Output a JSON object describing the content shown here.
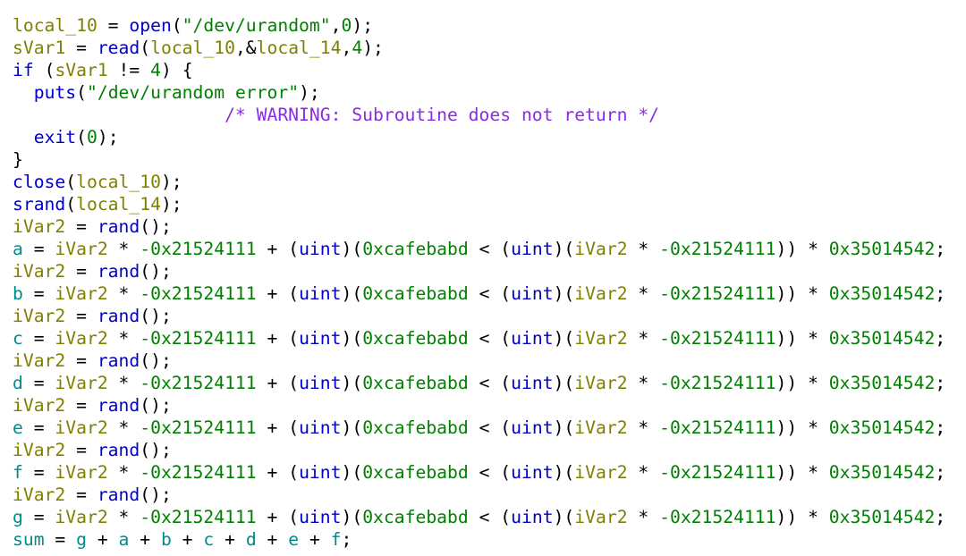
{
  "editor": {
    "lines": [
      [
        [
          "var",
          "local_10"
        ],
        [
          "plain",
          " = "
        ],
        [
          "func",
          "open"
        ],
        [
          "plain",
          "("
        ],
        [
          "string",
          "\"/dev/urandom\""
        ],
        [
          "plain",
          ","
        ],
        [
          "number",
          "0"
        ],
        [
          "plain",
          ");"
        ]
      ],
      [
        [
          "var",
          "sVar1"
        ],
        [
          "plain",
          " = "
        ],
        [
          "func",
          "read"
        ],
        [
          "plain",
          "("
        ],
        [
          "var",
          "local_10"
        ],
        [
          "plain",
          ",&"
        ],
        [
          "var",
          "local_14"
        ],
        [
          "plain",
          ","
        ],
        [
          "number",
          "4"
        ],
        [
          "plain",
          ");"
        ]
      ],
      [
        [
          "keyword",
          "if"
        ],
        [
          "plain",
          " ("
        ],
        [
          "var",
          "sVar1"
        ],
        [
          "plain",
          " != "
        ],
        [
          "number",
          "4"
        ],
        [
          "plain",
          ") {"
        ]
      ],
      [
        [
          "plain",
          "  "
        ],
        [
          "func",
          "puts"
        ],
        [
          "plain",
          "("
        ],
        [
          "string",
          "\"/dev/urandom error\""
        ],
        [
          "plain",
          ");"
        ]
      ],
      [
        [
          "plain",
          "                    "
        ],
        [
          "comment",
          "/* WARNING: Subroutine does not return */"
        ]
      ],
      [
        [
          "plain",
          "  "
        ],
        [
          "func",
          "exit"
        ],
        [
          "plain",
          "("
        ],
        [
          "number",
          "0"
        ],
        [
          "plain",
          ");"
        ]
      ],
      [
        [
          "plain",
          "}"
        ]
      ],
      [
        [
          "func",
          "close"
        ],
        [
          "plain",
          "("
        ],
        [
          "var",
          "local_10"
        ],
        [
          "plain",
          ");"
        ]
      ],
      [
        [
          "func",
          "srand"
        ],
        [
          "plain",
          "("
        ],
        [
          "var",
          "local_14"
        ],
        [
          "plain",
          ");"
        ]
      ],
      [
        [
          "var",
          "iVar2"
        ],
        [
          "plain",
          " = "
        ],
        [
          "func",
          "rand"
        ],
        [
          "plain",
          "();"
        ]
      ],
      [
        [
          "global",
          "a"
        ],
        [
          "plain",
          " = "
        ],
        [
          "var",
          "iVar2"
        ],
        [
          "plain",
          " * "
        ],
        [
          "number",
          "-0x21524111"
        ],
        [
          "plain",
          " + ("
        ],
        [
          "type",
          "uint"
        ],
        [
          "plain",
          ")("
        ],
        [
          "number",
          "0xcafebabd"
        ],
        [
          "plain",
          " < ("
        ],
        [
          "type",
          "uint"
        ],
        [
          "plain",
          ")("
        ],
        [
          "var",
          "iVar2"
        ],
        [
          "plain",
          " * "
        ],
        [
          "number",
          "-0x21524111"
        ],
        [
          "plain",
          ")) * "
        ],
        [
          "number",
          "0x35014542"
        ],
        [
          "plain",
          ";"
        ]
      ],
      [
        [
          "var",
          "iVar2"
        ],
        [
          "plain",
          " = "
        ],
        [
          "func",
          "rand"
        ],
        [
          "plain",
          "();"
        ]
      ],
      [
        [
          "global",
          "b"
        ],
        [
          "plain",
          " = "
        ],
        [
          "var",
          "iVar2"
        ],
        [
          "plain",
          " * "
        ],
        [
          "number",
          "-0x21524111"
        ],
        [
          "plain",
          " + ("
        ],
        [
          "type",
          "uint"
        ],
        [
          "plain",
          ")("
        ],
        [
          "number",
          "0xcafebabd"
        ],
        [
          "plain",
          " < ("
        ],
        [
          "type",
          "uint"
        ],
        [
          "plain",
          ")("
        ],
        [
          "var",
          "iVar2"
        ],
        [
          "plain",
          " * "
        ],
        [
          "number",
          "-0x21524111"
        ],
        [
          "plain",
          ")) * "
        ],
        [
          "number",
          "0x35014542"
        ],
        [
          "plain",
          ";"
        ]
      ],
      [
        [
          "var",
          "iVar2"
        ],
        [
          "plain",
          " = "
        ],
        [
          "func",
          "rand"
        ],
        [
          "plain",
          "();"
        ]
      ],
      [
        [
          "global",
          "c"
        ],
        [
          "plain",
          " = "
        ],
        [
          "var",
          "iVar2"
        ],
        [
          "plain",
          " * "
        ],
        [
          "number",
          "-0x21524111"
        ],
        [
          "plain",
          " + ("
        ],
        [
          "type",
          "uint"
        ],
        [
          "plain",
          ")("
        ],
        [
          "number",
          "0xcafebabd"
        ],
        [
          "plain",
          " < ("
        ],
        [
          "type",
          "uint"
        ],
        [
          "plain",
          ")("
        ],
        [
          "var",
          "iVar2"
        ],
        [
          "plain",
          " * "
        ],
        [
          "number",
          "-0x21524111"
        ],
        [
          "plain",
          ")) * "
        ],
        [
          "number",
          "0x35014542"
        ],
        [
          "plain",
          ";"
        ]
      ],
      [
        [
          "var",
          "iVar2"
        ],
        [
          "plain",
          " = "
        ],
        [
          "func",
          "rand"
        ],
        [
          "plain",
          "();"
        ]
      ],
      [
        [
          "global",
          "d"
        ],
        [
          "plain",
          " = "
        ],
        [
          "var",
          "iVar2"
        ],
        [
          "plain",
          " * "
        ],
        [
          "number",
          "-0x21524111"
        ],
        [
          "plain",
          " + ("
        ],
        [
          "type",
          "uint"
        ],
        [
          "plain",
          ")("
        ],
        [
          "number",
          "0xcafebabd"
        ],
        [
          "plain",
          " < ("
        ],
        [
          "type",
          "uint"
        ],
        [
          "plain",
          ")("
        ],
        [
          "var",
          "iVar2"
        ],
        [
          "plain",
          " * "
        ],
        [
          "number",
          "-0x21524111"
        ],
        [
          "plain",
          ")) * "
        ],
        [
          "number",
          "0x35014542"
        ],
        [
          "plain",
          ";"
        ]
      ],
      [
        [
          "var",
          "iVar2"
        ],
        [
          "plain",
          " = "
        ],
        [
          "func",
          "rand"
        ],
        [
          "plain",
          "();"
        ]
      ],
      [
        [
          "global",
          "e"
        ],
        [
          "plain",
          " = "
        ],
        [
          "var",
          "iVar2"
        ],
        [
          "plain",
          " * "
        ],
        [
          "number",
          "-0x21524111"
        ],
        [
          "plain",
          " + ("
        ],
        [
          "type",
          "uint"
        ],
        [
          "plain",
          ")("
        ],
        [
          "number",
          "0xcafebabd"
        ],
        [
          "plain",
          " < ("
        ],
        [
          "type",
          "uint"
        ],
        [
          "plain",
          ")("
        ],
        [
          "var",
          "iVar2"
        ],
        [
          "plain",
          " * "
        ],
        [
          "number",
          "-0x21524111"
        ],
        [
          "plain",
          ")) * "
        ],
        [
          "number",
          "0x35014542"
        ],
        [
          "plain",
          ";"
        ]
      ],
      [
        [
          "var",
          "iVar2"
        ],
        [
          "plain",
          " = "
        ],
        [
          "func",
          "rand"
        ],
        [
          "plain",
          "();"
        ]
      ],
      [
        [
          "global",
          "f"
        ],
        [
          "plain",
          " = "
        ],
        [
          "var",
          "iVar2"
        ],
        [
          "plain",
          " * "
        ],
        [
          "number",
          "-0x21524111"
        ],
        [
          "plain",
          " + ("
        ],
        [
          "type",
          "uint"
        ],
        [
          "plain",
          ")("
        ],
        [
          "number",
          "0xcafebabd"
        ],
        [
          "plain",
          " < ("
        ],
        [
          "type",
          "uint"
        ],
        [
          "plain",
          ")("
        ],
        [
          "var",
          "iVar2"
        ],
        [
          "plain",
          " * "
        ],
        [
          "number",
          "-0x21524111"
        ],
        [
          "plain",
          ")) * "
        ],
        [
          "number",
          "0x35014542"
        ],
        [
          "plain",
          ";"
        ]
      ],
      [
        [
          "var",
          "iVar2"
        ],
        [
          "plain",
          " = "
        ],
        [
          "func",
          "rand"
        ],
        [
          "plain",
          "();"
        ]
      ],
      [
        [
          "global",
          "g"
        ],
        [
          "plain",
          " = "
        ],
        [
          "var",
          "iVar2"
        ],
        [
          "plain",
          " * "
        ],
        [
          "number",
          "-0x21524111"
        ],
        [
          "plain",
          " + ("
        ],
        [
          "type",
          "uint"
        ],
        [
          "plain",
          ")("
        ],
        [
          "number",
          "0xcafebabd"
        ],
        [
          "plain",
          " < ("
        ],
        [
          "type",
          "uint"
        ],
        [
          "plain",
          ")("
        ],
        [
          "var",
          "iVar2"
        ],
        [
          "plain",
          " * "
        ],
        [
          "number",
          "-0x21524111"
        ],
        [
          "plain",
          ")) * "
        ],
        [
          "number",
          "0x35014542"
        ],
        [
          "plain",
          ";"
        ]
      ],
      [
        [
          "global",
          "sum"
        ],
        [
          "plain",
          " = "
        ],
        [
          "global",
          "g"
        ],
        [
          "plain",
          " + "
        ],
        [
          "global",
          "a"
        ],
        [
          "plain",
          " + "
        ],
        [
          "global",
          "b"
        ],
        [
          "plain",
          " + "
        ],
        [
          "global",
          "c"
        ],
        [
          "plain",
          " + "
        ],
        [
          "global",
          "d"
        ],
        [
          "plain",
          " + "
        ],
        [
          "global",
          "e"
        ],
        [
          "plain",
          " + "
        ],
        [
          "global",
          "f"
        ],
        [
          "plain",
          ";"
        ]
      ]
    ]
  },
  "colors": {
    "plain": "#000000",
    "var": "#808000",
    "global": "#008b8b",
    "func": "#0000cd",
    "keyword": "#0000cd",
    "type": "#0000cd",
    "string": "#008000",
    "number": "#008000",
    "comment": "#8a2be2",
    "background": "#ffffff"
  }
}
